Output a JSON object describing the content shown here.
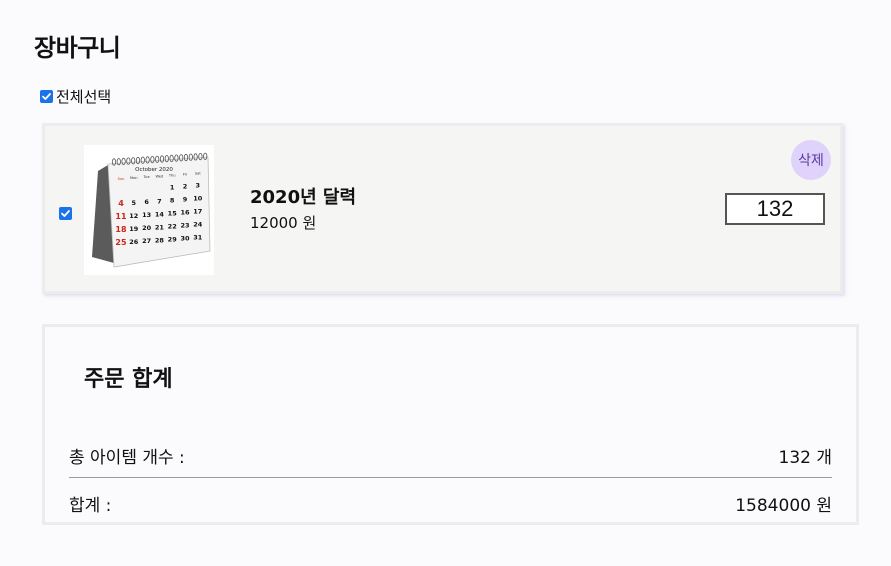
{
  "page": {
    "title": "장바구니"
  },
  "select_all": {
    "label": "전체선택",
    "checked": true
  },
  "cart": {
    "items": [
      {
        "name": "2020년 달력",
        "price_text": "12000 원",
        "quantity": "132",
        "delete_label": "삭제",
        "checked": true,
        "image": {
          "icon": "desk-calendar-image",
          "month_label": "October 2020",
          "weekdays": [
            "Sun",
            "Mon",
            "Tue",
            "Wed",
            "Thu",
            "Fri",
            "Sat"
          ],
          "weeks": [
            [
              "",
              "",
              "",
              "",
              "1",
              "2",
              "3"
            ],
            [
              "4",
              "5",
              "6",
              "7",
              "8",
              "9",
              "10"
            ],
            [
              "11",
              "12",
              "13",
              "14",
              "15",
              "16",
              "17"
            ],
            [
              "18",
              "19",
              "20",
              "21",
              "22",
              "23",
              "24"
            ],
            [
              "25",
              "26",
              "27",
              "28",
              "29",
              "30",
              "31"
            ]
          ]
        }
      }
    ]
  },
  "summary": {
    "title": "주문 합계",
    "count_label": "총 아이템 개수 :",
    "count_value": "132 개",
    "total_label": "합계 :",
    "total_value": "1584000 원"
  },
  "colors": {
    "accent": "#1a73e8",
    "delete_bg": "#e0d3fb",
    "delete_text": "#5a3aa0",
    "calendar_red": "#d0241b"
  }
}
